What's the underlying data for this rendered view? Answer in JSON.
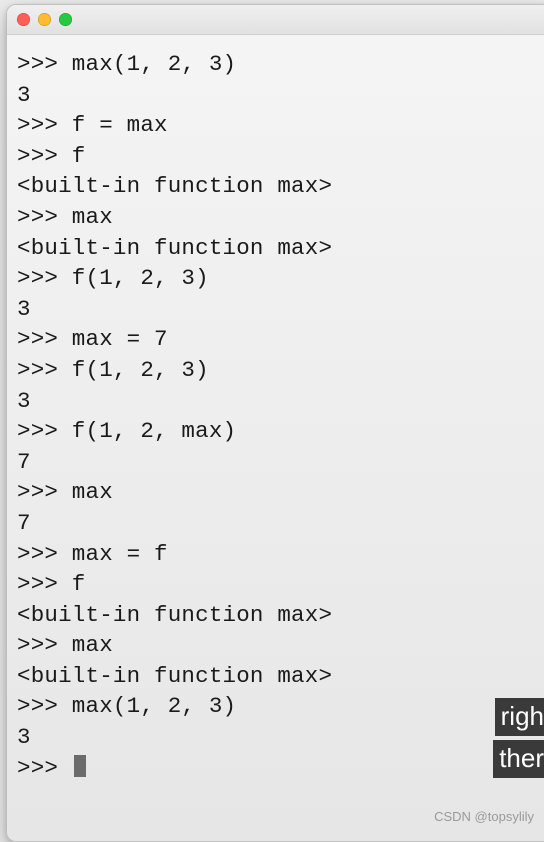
{
  "terminal": {
    "prompt": ">>>",
    "lines": [
      {
        "type": "input",
        "text": ">>> max(1, 2, 3)"
      },
      {
        "type": "output",
        "text": "3"
      },
      {
        "type": "input",
        "text": ">>> f = max"
      },
      {
        "type": "input",
        "text": ">>> f"
      },
      {
        "type": "output",
        "text": "<built-in function max>"
      },
      {
        "type": "input",
        "text": ">>> max"
      },
      {
        "type": "output",
        "text": "<built-in function max>"
      },
      {
        "type": "input",
        "text": ">>> f(1, 2, 3)"
      },
      {
        "type": "output",
        "text": "3"
      },
      {
        "type": "input",
        "text": ">>> max = 7"
      },
      {
        "type": "input",
        "text": ">>> f(1, 2, 3)"
      },
      {
        "type": "output",
        "text": "3"
      },
      {
        "type": "input",
        "text": ">>> f(1, 2, max)"
      },
      {
        "type": "output",
        "text": "7"
      },
      {
        "type": "input",
        "text": ">>> max"
      },
      {
        "type": "output",
        "text": "7"
      },
      {
        "type": "input",
        "text": ">>> max = f"
      },
      {
        "type": "input",
        "text": ">>> f"
      },
      {
        "type": "output",
        "text": "<built-in function max>"
      },
      {
        "type": "input",
        "text": ">>> max"
      },
      {
        "type": "output",
        "text": "<built-in function max>"
      },
      {
        "type": "input",
        "text": ">>> max(1, 2, 3)"
      },
      {
        "type": "output",
        "text": "3"
      },
      {
        "type": "prompt",
        "text": ">>> "
      }
    ]
  },
  "caption": {
    "line1": "righ",
    "line2": "ther"
  },
  "watermark": "CSDN @topsylily"
}
